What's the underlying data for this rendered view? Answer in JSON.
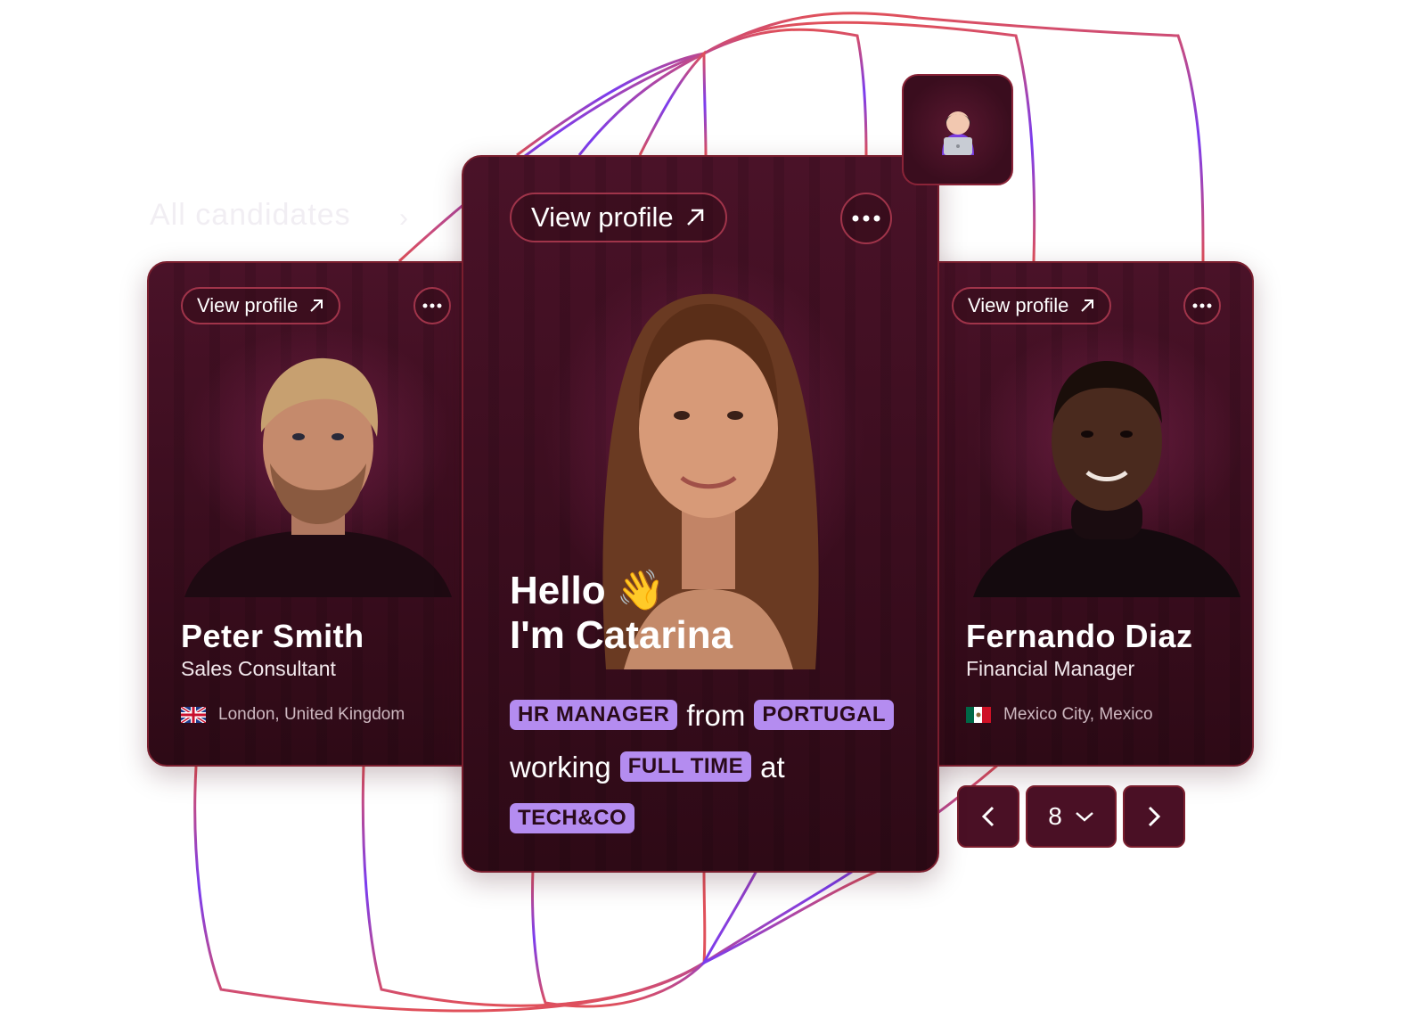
{
  "background_link": {
    "label": "All candidates"
  },
  "cards": [
    {
      "view_profile_label": "View profile",
      "name": "Peter Smith",
      "role": "Sales Consultant",
      "location": "London, United Kingdom",
      "flag": "uk-flag-icon"
    },
    {
      "view_profile_label": "View profile",
      "greeting_line1": "Hello",
      "greeting_emoji": "👋",
      "greeting_line2": "I'm Catarina",
      "tags": {
        "role": "HR MANAGER",
        "country": "PORTUGAL",
        "schedule": "FULL TIME",
        "company": "TECH&CO"
      },
      "words": {
        "from": "from",
        "working": "working",
        "at": "at"
      }
    },
    {
      "view_profile_label": "View profile",
      "name": "Fernando Diaz",
      "role": "Financial Manager",
      "location": "Mexico City, Mexico",
      "flag": "mexico-flag-icon"
    }
  ],
  "emoji_badge": {
    "icon": "woman-technologist-icon"
  },
  "pagination": {
    "page": "8"
  },
  "colors": {
    "card_bg": "#3a0d1e",
    "card_border": "#7a1e2e",
    "tag_bg": "#b48cf0",
    "line_red": "#e0505a",
    "line_purple": "#7a3cf0"
  }
}
